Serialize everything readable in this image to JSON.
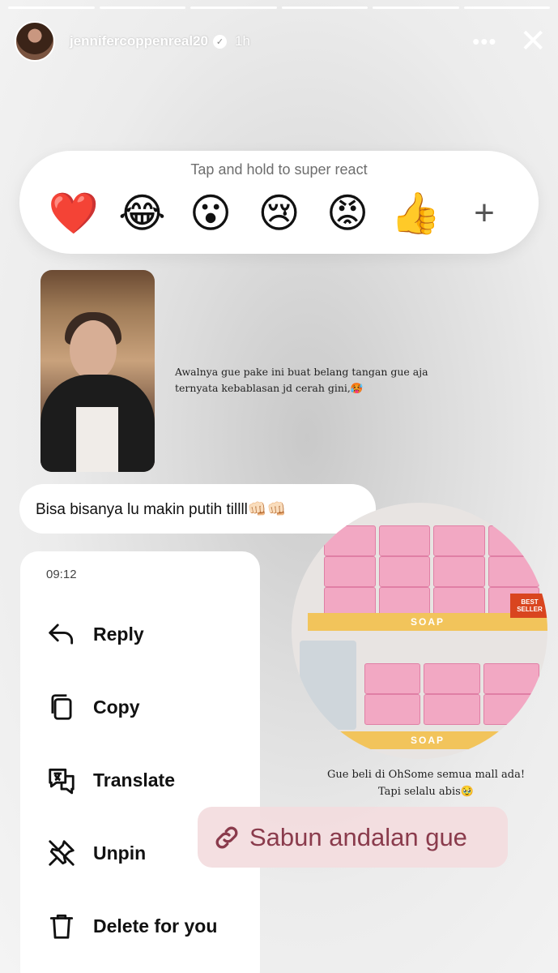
{
  "story": {
    "username": "jennifercoppenreal20",
    "time_ago": "1h",
    "progress_segments": 6
  },
  "reactions": {
    "hint": "Tap and hold to super react",
    "emojis": [
      "❤️",
      "😂",
      "😮",
      "😢",
      "😡",
      "👍"
    ],
    "plus": "+"
  },
  "post": {
    "caption_1": "Awalnya gue pake ini buat belang tangan gue aja ternyata kebablasan jd cerah gini,🥵",
    "caption_2": "Gue beli di OhSome semua mall ada! Tapi selalu abis🥹",
    "shelf_label_1": "SOAP",
    "shelf_label_2": "SOAP",
    "badge": "BEST SELLER"
  },
  "message": {
    "text": "Bisa bisanya lu makin putih tillll👊🏻👊🏻"
  },
  "context_menu": {
    "timestamp": "09:12",
    "items": [
      {
        "label": "Reply",
        "icon": "reply-icon"
      },
      {
        "label": "Copy",
        "icon": "copy-icon"
      },
      {
        "label": "Translate",
        "icon": "translate-icon"
      },
      {
        "label": "Unpin",
        "icon": "unpin-icon"
      },
      {
        "label": "Delete for you",
        "icon": "trash-icon"
      }
    ]
  },
  "link_sticker": {
    "label": "Sabun andalan gue",
    "icon": "link-icon",
    "color": "#8a3b4c"
  }
}
